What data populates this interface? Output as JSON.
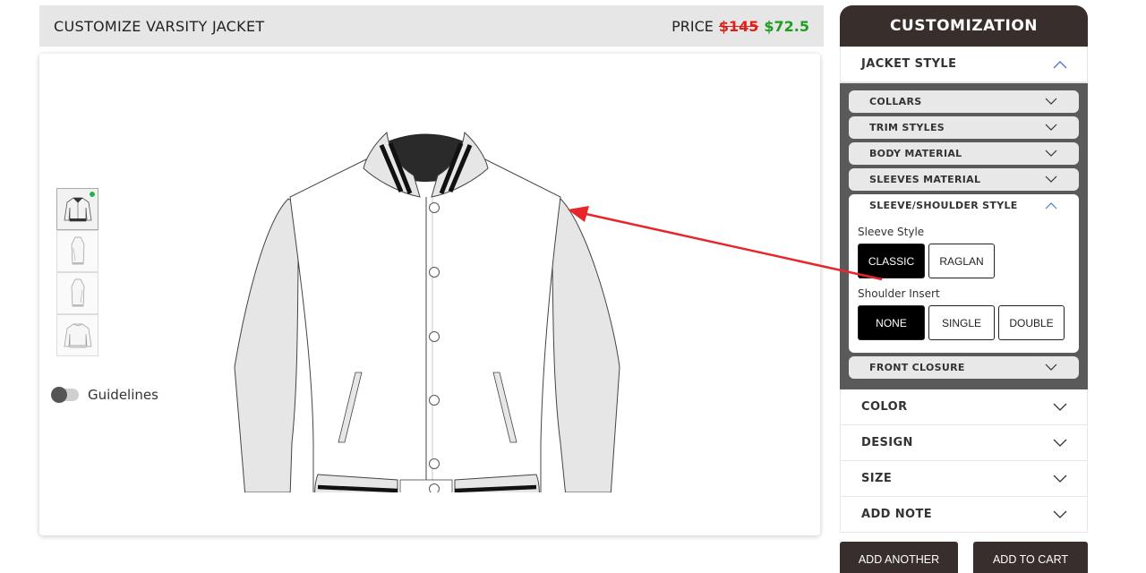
{
  "header": {
    "title": "CUSTOMIZE VARSITY JACKET",
    "price_label": "PRICE",
    "price_old": "$145",
    "price_new": "$72.5"
  },
  "canvas": {
    "guidelines_label": "Guidelines",
    "thumbnails": [
      "front-view",
      "left-side-view",
      "right-side-view",
      "back-view"
    ]
  },
  "panel": {
    "title": "CUSTOMIZATION",
    "jacket_style": {
      "label": "JACKET STYLE",
      "sections": [
        {
          "label": "COLLARS"
        },
        {
          "label": "TRIM STYLES"
        },
        {
          "label": "BODY MATERIAL"
        },
        {
          "label": "SLEEVES MATERIAL"
        }
      ],
      "sleeve_shoulder": {
        "label": "SLEEVE/SHOULDER STYLE",
        "sleeve_style_label": "Sleeve Style",
        "sleeve_options": [
          "CLASSIC",
          "RAGLAN"
        ],
        "sleeve_selected": "CLASSIC",
        "shoulder_insert_label": "Shoulder Insert",
        "shoulder_options": [
          "NONE",
          "SINGLE",
          "DOUBLE"
        ],
        "shoulder_selected": "NONE"
      },
      "front_closure": "FRONT CLOSURE"
    },
    "color": "COLOR",
    "design": "DESIGN",
    "size": "SIZE",
    "add_note": "ADD NOTE"
  },
  "actions": {
    "add_another": "ADD ANOTHER",
    "add_to_cart": "ADD TO CART"
  },
  "colors": {
    "panel_dark": "#382f2d",
    "price_old": "#e0201b",
    "price_new": "#1f9d1f",
    "arrow": "#e8262a"
  }
}
